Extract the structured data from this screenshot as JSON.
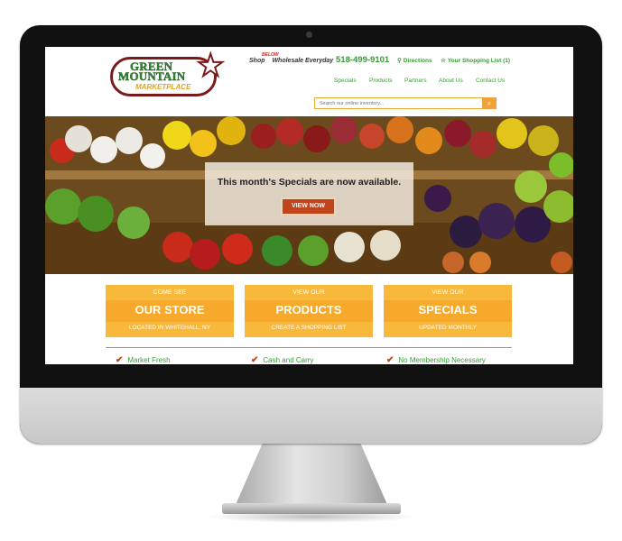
{
  "logo": {
    "line1": "GREEN",
    "line2": "MOUNTAIN",
    "line3": "MARKETPLACE"
  },
  "header": {
    "tagline_shop": "Shop",
    "tagline_below": "BELOW",
    "tagline_rest": "Wholesale Everyday",
    "phone": "518-499-9101",
    "directions": "Directions",
    "shopping_list": "Your Shopping List (1)",
    "nav": [
      "Specials",
      "Products",
      "Partners",
      "About Us",
      "Contact Us"
    ]
  },
  "search": {
    "placeholder": "Search our online inventory..."
  },
  "hero": {
    "message": "This month's Specials are now available.",
    "button": "VIEW NOW"
  },
  "cards": [
    {
      "top": "COME SEE",
      "title": "OUR STORE",
      "bottom": "LOCATED IN WHITEHALL, NY"
    },
    {
      "top": "VIEW OUR",
      "title": "PRODUCTS",
      "bottom": "CREATE A SHOPPING LIST"
    },
    {
      "top": "VIEW OUR",
      "title": "SPECIALS",
      "bottom": "UPDATED MONTHLY"
    }
  ],
  "features": [
    "Market Fresh",
    "Cash and Carry",
    "No Membership Necessary"
  ],
  "colors": {
    "green": "#3a9a3a",
    "orange": "#f7b83c",
    "button": "#c0451d",
    "logo_border": "#7a1a1a"
  }
}
